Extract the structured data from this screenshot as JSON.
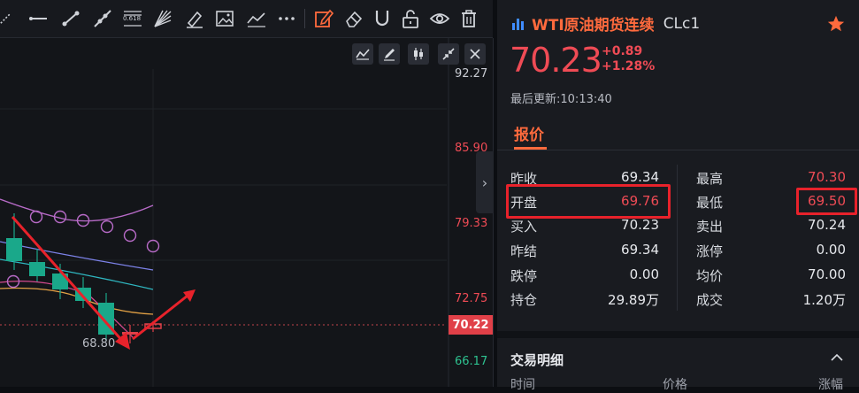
{
  "toolbar": {
    "icons": [
      "ray-tool",
      "horizontal-line-tool",
      "trend-line-tool",
      "extended-line-tool",
      "fibonacci-tool",
      "gann-fan-tool",
      "brush-tool",
      "image-tool",
      "polyline-tool",
      "more-tools",
      "edit-tool",
      "eraser-tool",
      "magnet-tool",
      "unlock-tool",
      "visibility-tool",
      "delete-tool"
    ],
    "fib_text": "0.618",
    "active_color": "#ff6a3d"
  },
  "chart": {
    "y_axis": [
      {
        "value": "92.27",
        "color": "#c9ccd3"
      },
      {
        "value": "85.90",
        "color": "#ef4b55"
      },
      {
        "value": "79.33",
        "color": "#ef4b55"
      },
      {
        "value": "72.75",
        "color": "#ef4b55"
      },
      {
        "value": "66.17",
        "color": "#2ec290"
      }
    ],
    "last_price": "70.22",
    "low_label": "68.80",
    "up_color": "#ef4b55",
    "down_color": "#1aa88a",
    "controls": [
      "line-chart-icon",
      "draw-icon",
      "candle-icon",
      "collapse-arrows-icon",
      "close-icon"
    ]
  },
  "quote": {
    "name": "WTI原油期货连续",
    "code": "CLc1",
    "price": "70.23",
    "change": "+0.89",
    "change_pct": "+1.28%",
    "update_label": "最后更新:",
    "update_time": "10:13:40",
    "tab": "报价",
    "rows": [
      [
        {
          "k": "昨收",
          "v": "69.34",
          "red": false
        },
        {
          "k": "最高",
          "v": "70.30",
          "red": true
        }
      ],
      [
        {
          "k": "开盘",
          "v": "69.76",
          "red": true
        },
        {
          "k": "最低",
          "v": "69.50",
          "red": true
        }
      ],
      [
        {
          "k": "买入",
          "v": "70.23",
          "red": false
        },
        {
          "k": "卖出",
          "v": "70.24",
          "red": false
        }
      ],
      [
        {
          "k": "昨结",
          "v": "69.34",
          "red": false
        },
        {
          "k": "涨停",
          "v": "0.00",
          "red": false
        }
      ],
      [
        {
          "k": "跌停",
          "v": "0.00",
          "red": false
        },
        {
          "k": "均价",
          "v": "70.00",
          "red": false
        }
      ],
      [
        {
          "k": "持仓",
          "v": "29.89万",
          "red": false
        },
        {
          "k": "成交",
          "v": "1.20万",
          "red": false
        }
      ]
    ],
    "trade_title": "交易明细",
    "trade_headers": [
      "时间",
      "价格",
      "涨幅"
    ]
  }
}
